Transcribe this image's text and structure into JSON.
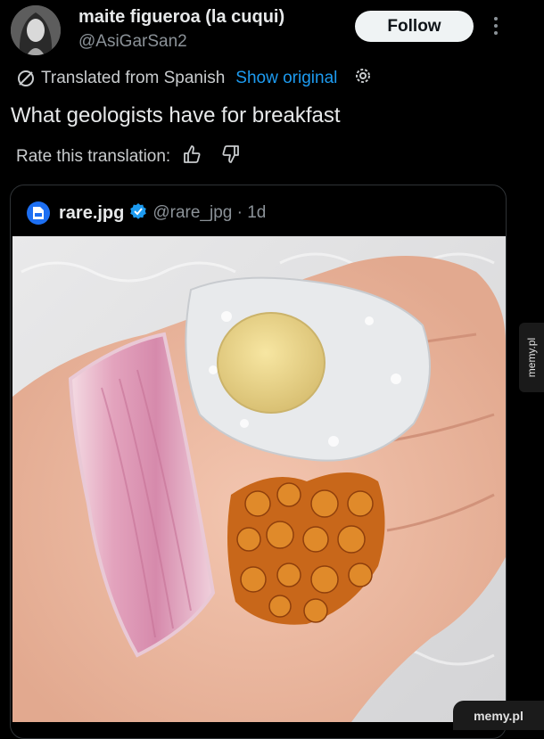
{
  "tweet": {
    "display_name": "maite figueroa (la cuqui)",
    "handle": "@AsiGarSan2",
    "follow_label": "Follow",
    "translated_label": "Translated from Spanish",
    "show_original_label": "Show original",
    "text": "What geologists have for breakfast",
    "rate_label": "Rate this translation:"
  },
  "quote": {
    "name": "rare.jpg",
    "handle_time": "@rare_jpg · 1d"
  },
  "watermark": {
    "side": "memy.pl",
    "corner": "memy.pl"
  },
  "icons": [
    "more-vertical-icon",
    "translate-icon",
    "gear-icon",
    "thumbs-up-icon",
    "thumbs-down-icon",
    "verified-badge-icon"
  ],
  "colors": {
    "background": "#000000",
    "text": "#e7e9ea",
    "secondary": "#8b9298",
    "link": "#1d9bf0",
    "follow_bg": "#eff3f4",
    "border": "#2f3336"
  }
}
